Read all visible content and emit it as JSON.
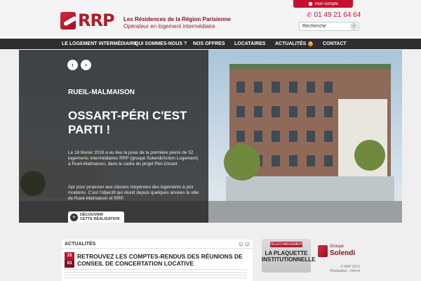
{
  "header": {
    "account_label": "mon compte",
    "logo_text": "RRP",
    "tagline_line1": "Les Résidences de la Région Parisienne",
    "tagline_line2": "Opérateur en logement intermédiaire",
    "phone": "01 49 21 64 64",
    "search_value": "Recherche"
  },
  "nav": {
    "items": [
      {
        "label": "LE LOGEMENT INTERMÉDIAIRE"
      },
      {
        "label": "QUI SOMMES-NOUS ?"
      },
      {
        "label": "NOS OFFRES"
      },
      {
        "label": "LOCATAIRES"
      },
      {
        "label": "ACTUALITÉS",
        "badge": "5"
      },
      {
        "label": "CONTACT"
      }
    ]
  },
  "hero": {
    "city": "RUEIL-MALMAISON",
    "title": "OSSART-PÉRI C'EST PARTI !",
    "paragraph1": "Le 18 février 2016 a eu lieu la pose de la première pierre de 52 logements intermédiaires RRP (groupe Solendi/Action Logement) à Rueil-Malmaison, dans le cadre du projet Péri-Ossart.",
    "paragraph2": "Apr pour proposer aux classes moyennes des logements à prix modérés. C'est l'objectif qui réunit depuis quelques années la ville de Rueil-Malmaison et RRP.",
    "discover_line1": "DÉCOUVRIR",
    "discover_line2": "CETTE RÉALISATION"
  },
  "news": {
    "heading": "ACTUALITÉS",
    "date_day": "15",
    "date_month": "03",
    "title": "RETROUVEZ LES COMPTES-RENDUS DES RÉUNIONS DE CONSEIL DE CONCERTATION LOCATIVE"
  },
  "plaquette": {
    "label_top": "TÉLÉCHARGEMENT",
    "label_main": "LA PLAQUETTE INSTITUTIONNELLE"
  },
  "footer": {
    "group_line1": "Groupe",
    "group_line2": "Solendi",
    "copyright": "© RRP 2013",
    "credit": "Réalisation : Inferel"
  }
}
